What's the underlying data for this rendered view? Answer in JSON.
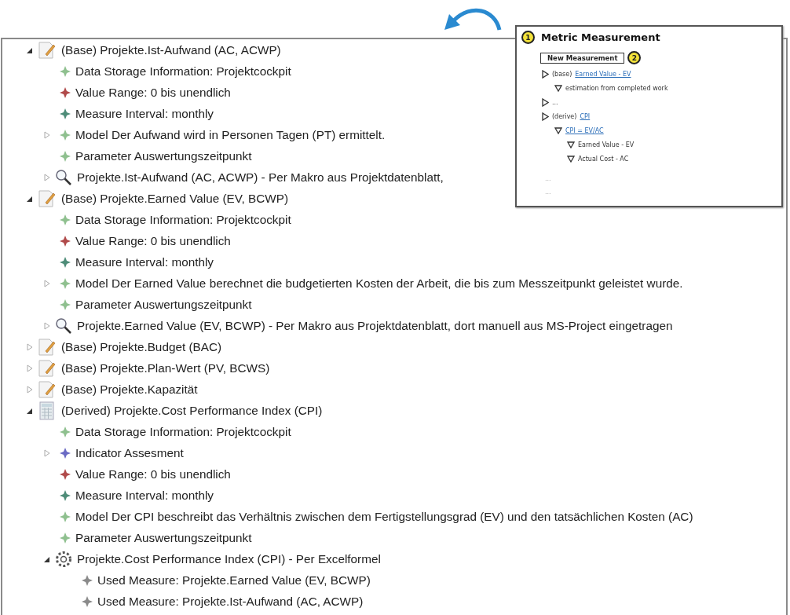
{
  "tree": [
    {
      "kind": "document",
      "text": "(Base) Projekte.Ist-Aufwand (AC, ACWP)",
      "expanded": true,
      "children": [
        {
          "kind": "diamond",
          "color": "#8fc08f",
          "text": "Data Storage Information: Projektcockpit"
        },
        {
          "kind": "diamond",
          "color": "#b04a4a",
          "text": "Value Range: 0 bis unendlich"
        },
        {
          "kind": "diamond",
          "color": "#4e8c78",
          "text": "Measure Interval: monthly"
        },
        {
          "kind": "diamond",
          "color": "#8fc08f",
          "text": "Model Der Aufwand wird in Personen Tagen (PT) ermittelt.",
          "expanded": false
        },
        {
          "kind": "diamond",
          "color": "#8fc08f",
          "text": "Parameter Auswertungszeitpunkt"
        },
        {
          "kind": "search",
          "text": "Projekte.Ist-Aufwand (AC, ACWP) - Per Makro aus Projektdatenblatt,",
          "expanded": false
        }
      ]
    },
    {
      "kind": "document",
      "text": "(Base) Projekte.Earned Value (EV, BCWP)",
      "expanded": true,
      "children": [
        {
          "kind": "diamond",
          "color": "#8fc08f",
          "text": "Data Storage Information: Projektcockpit"
        },
        {
          "kind": "diamond",
          "color": "#b04a4a",
          "text": "Value Range: 0 bis unendlich"
        },
        {
          "kind": "diamond",
          "color": "#4e8c78",
          "text": "Measure Interval: monthly"
        },
        {
          "kind": "diamond",
          "color": "#8fc08f",
          "text": "Model Der Earned Value berechnet die budgetierten Kosten der Arbeit, die bis zum Messzeitpunkt geleistet wurde.",
          "expanded": false
        },
        {
          "kind": "diamond",
          "color": "#8fc08f",
          "text": "Parameter Auswertungszeitpunkt"
        },
        {
          "kind": "search",
          "text": "Projekte.Earned Value (EV, BCWP) - Per Makro aus Projektdatenblatt, dort manuell aus MS-Project eingetragen",
          "expanded": false
        }
      ]
    },
    {
      "kind": "document",
      "text": "(Base) Projekte.Budget (BAC)",
      "expanded": false
    },
    {
      "kind": "document",
      "text": "(Base) Projekte.Plan-Wert (PV, BCWS)",
      "expanded": false
    },
    {
      "kind": "document",
      "text": "(Base) Projekte.Kapazität",
      "expanded": false
    },
    {
      "kind": "calculator",
      "text": "(Derived) Projekte.Cost Performance Index (CPI)",
      "expanded": true,
      "children": [
        {
          "kind": "diamond",
          "color": "#8fc08f",
          "text": "Data Storage Information: Projektcockpit"
        },
        {
          "kind": "diamond",
          "color": "#6a6ac4",
          "text": "Indicator Assesment",
          "expanded": false
        },
        {
          "kind": "diamond",
          "color": "#b04a4a",
          "text": "Value Range: 0 bis unendlich"
        },
        {
          "kind": "diamond",
          "color": "#4e8c78",
          "text": "Measure Interval: monthly"
        },
        {
          "kind": "diamond",
          "color": "#8fc08f",
          "text": "Model Der CPI beschreibt das Verhältnis zwischen dem Fertigstellungsgrad (EV) und den tatsächlichen Kosten (AC)"
        },
        {
          "kind": "diamond",
          "color": "#8fc08f",
          "text": "Parameter Auswertungszeitpunkt"
        },
        {
          "kind": "gear",
          "text": "Projekte.Cost Performance Index (CPI) - Per Excelformel",
          "expanded": true,
          "children": [
            {
              "kind": "diamond",
              "color": "#8a8a8a",
              "text": "Used Measure: Projekte.Earned Value (EV, BCWP)"
            },
            {
              "kind": "diamond",
              "color": "#8a8a8a",
              "text": "Used Measure: Projekte.Ist-Aufwand (AC, ACWP)"
            }
          ]
        }
      ]
    }
  ],
  "mockup": {
    "badge": "1",
    "title": "Metric Measurement",
    "button": {
      "label": "New Measurement",
      "badge": "2"
    },
    "items": [
      {
        "prefix": "(base)",
        "link": "Earned Value - EV",
        "expanded": false,
        "children": [
          {
            "prefix": "estimation from completed work",
            "expanded": true
          }
        ]
      },
      {
        "prefix": "...",
        "expanded": false
      },
      {
        "prefix": "(derive)",
        "link": "CPI",
        "expanded": false,
        "children": [
          {
            "link": "CPI = EV/AC",
            "expanded": true,
            "children": [
              {
                "prefix": "Earned Value - EV",
                "expanded": true
              },
              {
                "prefix": "Actual Cost - AC",
                "expanded": true
              }
            ]
          }
        ]
      }
    ],
    "notes": [
      "...",
      "..."
    ]
  }
}
